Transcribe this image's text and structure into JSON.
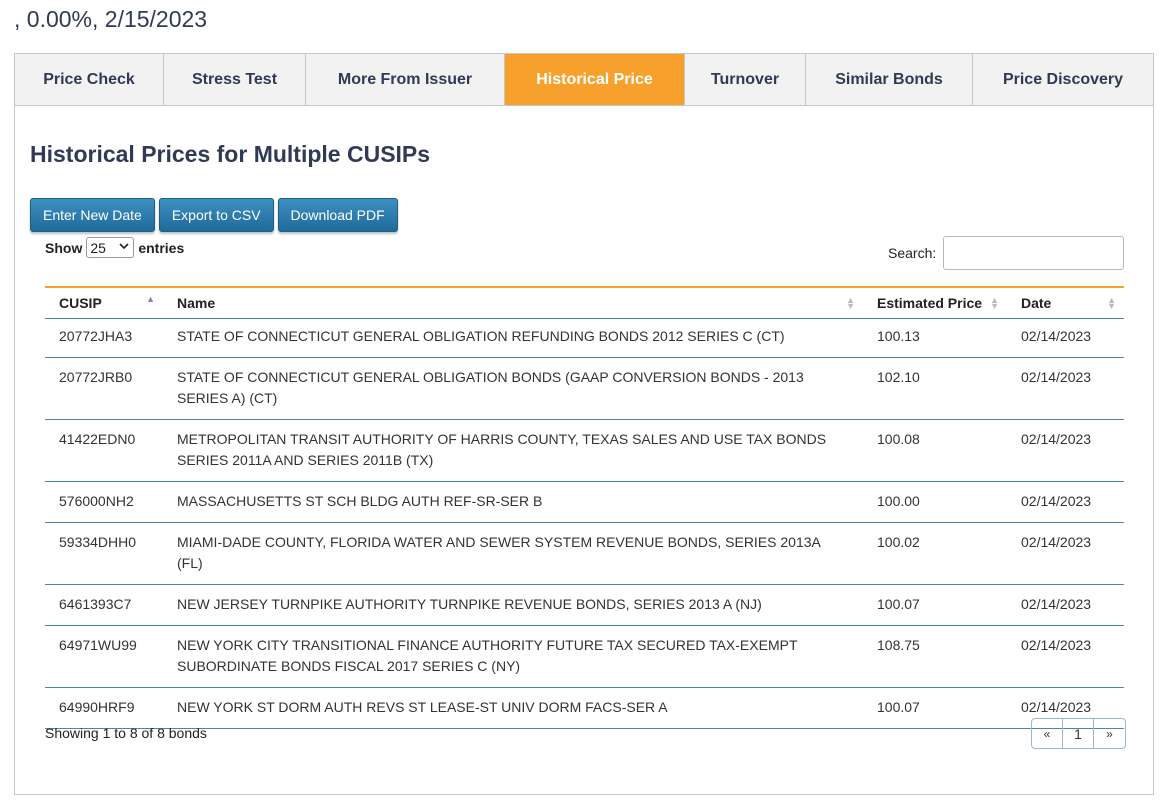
{
  "header": {
    "summary": ", 0.00%, 2/15/2023"
  },
  "tabs": [
    {
      "label": "Price Check",
      "width": 149
    },
    {
      "label": "Stress Test",
      "width": 142
    },
    {
      "label": "More From Issuer",
      "width": 199
    },
    {
      "label": "Historical Price",
      "width": 180
    },
    {
      "label": "Turnover",
      "width": 121
    },
    {
      "label": "Similar Bonds",
      "width": 167
    },
    {
      "label": "Price Discovery",
      "width": 180
    }
  ],
  "active_tab": "Historical Price",
  "colors": {
    "accent": "#f7a12c",
    "button": "#2a7bab",
    "title": "#2f3a55"
  },
  "page": {
    "title": "Historical Prices for Multiple CUSIPs"
  },
  "buttons": {
    "enter_new_date": "Enter New Date",
    "export_csv": "Export to CSV",
    "download_pdf": "Download PDF"
  },
  "length": {
    "show": "Show",
    "value": "25",
    "entries": "entries"
  },
  "search": {
    "label": "Search:",
    "value": ""
  },
  "table": {
    "columns": [
      "CUSIP",
      "Name",
      "Estimated Price",
      "Date"
    ],
    "rows": [
      {
        "cusip": "20772JHA3",
        "name": "STATE OF CONNECTICUT GENERAL OBLIGATION REFUNDING BONDS 2012 SERIES C (CT)",
        "price": "100.13",
        "date": "02/14/2023"
      },
      {
        "cusip": "20772JRB0",
        "name": "STATE OF CONNECTICUT GENERAL OBLIGATION BONDS (GAAP CONVERSION BONDS - 2013 SERIES A) (CT)",
        "price": "102.10",
        "date": "02/14/2023"
      },
      {
        "cusip": "41422EDN0",
        "name": "METROPOLITAN TRANSIT AUTHORITY OF HARRIS COUNTY, TEXAS SALES AND USE TAX BONDS SERIES 2011A AND SERIES 2011B (TX)",
        "price": "100.08",
        "date": "02/14/2023"
      },
      {
        "cusip": "576000NH2",
        "name": "MASSACHUSETTS ST SCH BLDG AUTH REF-SR-SER B",
        "price": "100.00",
        "date": "02/14/2023"
      },
      {
        "cusip": "59334DHH0",
        "name": "MIAMI-DADE COUNTY, FLORIDA WATER AND SEWER SYSTEM REVENUE BONDS, SERIES 2013A (FL)",
        "price": "100.02",
        "date": "02/14/2023"
      },
      {
        "cusip": "6461393C7",
        "name": "NEW JERSEY TURNPIKE AUTHORITY TURNPIKE REVENUE BONDS, SERIES 2013 A (NJ)",
        "price": "100.07",
        "date": "02/14/2023"
      },
      {
        "cusip": "64971WU99",
        "name": "NEW YORK CITY TRANSITIONAL FINANCE AUTHORITY FUTURE TAX SECURED TAX-EXEMPT SUBORDINATE BONDS FISCAL 2017 SERIES C (NY)",
        "price": "108.75",
        "date": "02/14/2023"
      },
      {
        "cusip": "64990HRF9",
        "name": "NEW YORK ST DORM AUTH REVS ST LEASE-ST UNIV DORM FACS-SER A",
        "price": "100.07",
        "date": "02/14/2023"
      }
    ]
  },
  "footer": {
    "info": "Showing 1 to 8 of 8 bonds"
  },
  "pagination": {
    "prev": "«",
    "current": "1",
    "next": "»"
  }
}
